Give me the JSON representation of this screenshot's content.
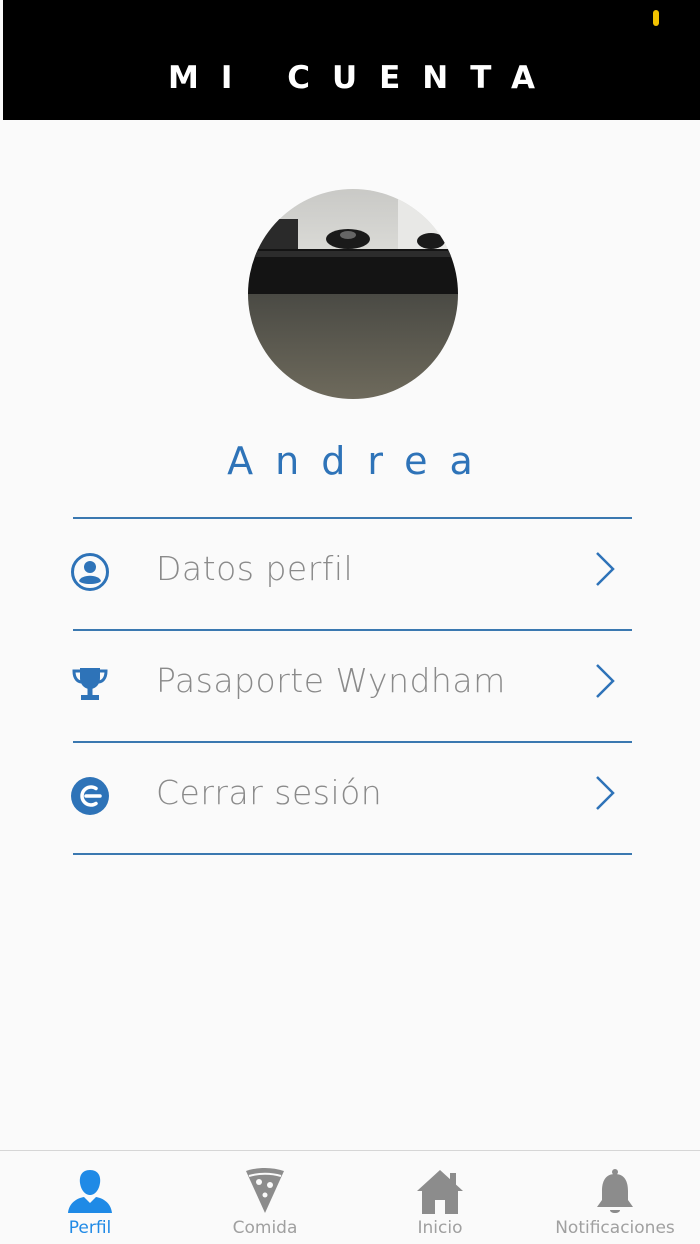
{
  "header": {
    "title": "MI CUENTA"
  },
  "profile": {
    "name": "Andrea"
  },
  "menu": {
    "items": [
      {
        "label": "Datos perfil",
        "icon": "user-circle-icon"
      },
      {
        "label": "Pasaporte Wyndham",
        "icon": "trophy-icon"
      },
      {
        "label": "Cerrar sesión",
        "icon": "logout-icon"
      }
    ]
  },
  "tabbar": {
    "tabs": [
      {
        "label": "Perfil",
        "icon": "person-icon",
        "active": true
      },
      {
        "label": "Comida",
        "icon": "pizza-icon",
        "active": false
      },
      {
        "label": "Inicio",
        "icon": "home-icon",
        "active": false
      },
      {
        "label": "Notificaciones",
        "icon": "bell-icon",
        "active": false
      }
    ]
  },
  "colors": {
    "accent": "#2e73b8",
    "tab_active": "#1f8ae6",
    "tab_inactive": "#a0a0a0",
    "header_bg": "#000000",
    "status_indicator": "#f2c200"
  }
}
